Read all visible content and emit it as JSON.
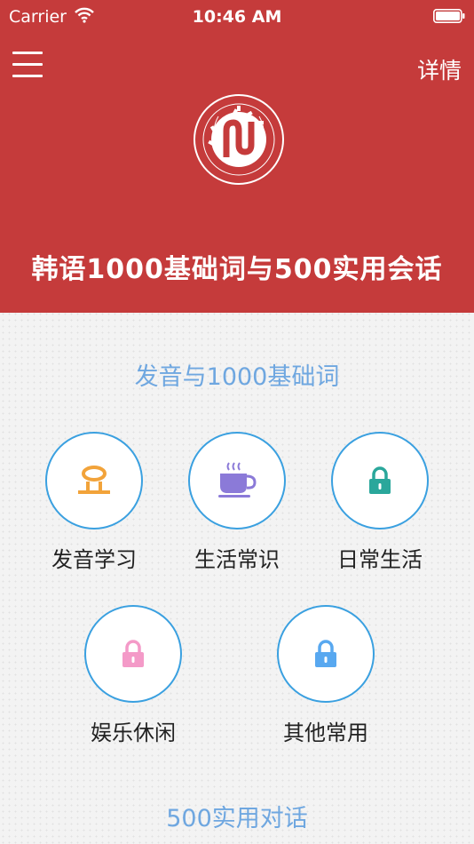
{
  "status_bar": {
    "carrier": "Carrier",
    "time": "10:46 AM"
  },
  "header": {
    "detail_label": "详情",
    "app_title": "韩语1000基础词与500实用会话",
    "brand_color": "#c53b3b"
  },
  "sections": {
    "basic_words": {
      "title": "发音与1000基础词",
      "items": [
        {
          "label": "发音学习",
          "icon": "pronunciation-glyph-icon",
          "color": "#f2a33a",
          "locked": false
        },
        {
          "label": "生活常识",
          "icon": "coffee-cup-icon",
          "color": "#8b7ad8",
          "locked": false
        },
        {
          "label": "日常生活",
          "icon": "lock-icon",
          "color": "#2aa79b",
          "locked": true
        },
        {
          "label": "娱乐休闲",
          "icon": "lock-icon",
          "color": "#f49ac8",
          "locked": true
        },
        {
          "label": "其他常用",
          "icon": "lock-icon",
          "color": "#58a8f0",
          "locked": true
        }
      ]
    },
    "dialogues": {
      "title": "500实用对话"
    }
  },
  "colors": {
    "accent_blue": "#3aa0e0",
    "section_title": "#6fa7e0"
  }
}
